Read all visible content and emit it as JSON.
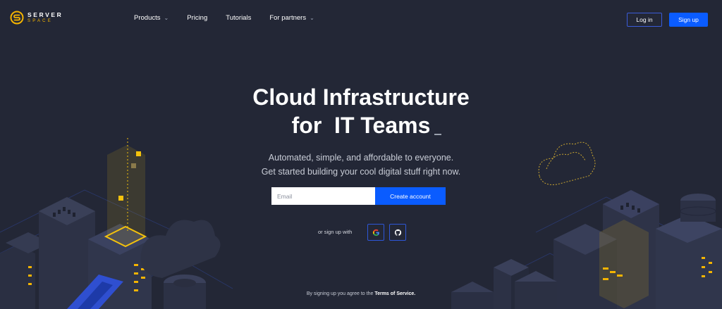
{
  "brand": {
    "name_top": "SERVER",
    "name_bottom": "SPACE"
  },
  "nav": {
    "items": [
      {
        "label": "Products",
        "has_dropdown": true
      },
      {
        "label": "Pricing",
        "has_dropdown": false
      },
      {
        "label": "Tutorials",
        "has_dropdown": false
      },
      {
        "label": "For partners",
        "has_dropdown": true
      }
    ]
  },
  "header": {
    "login_label": "Log in",
    "signup_label": "Sign up"
  },
  "hero": {
    "title_line1": "Cloud Infrastructure",
    "title_line2": "for  IT Teams",
    "subtitle_line1": "Automated, simple, and affordable to everyone.",
    "subtitle_line2": "Get started building your cool digital stuff right now."
  },
  "signup_form": {
    "email_placeholder": "Email",
    "create_label": "Create account",
    "or_label": "or sign up with",
    "providers": [
      "google-icon",
      "github-icon"
    ]
  },
  "footer": {
    "terms_prefix": "By signing up you agree to the ",
    "terms_link": "Terms of Service."
  },
  "colors": {
    "background": "#232736",
    "accent_blue": "#0a5cff",
    "accent_yellow": "#f4b400"
  }
}
